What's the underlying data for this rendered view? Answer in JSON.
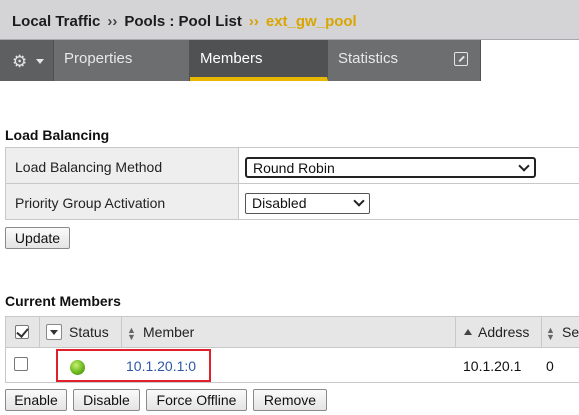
{
  "breadcrumb": {
    "section": "Local Traffic",
    "separator": "››",
    "page": "Pools : Pool List",
    "current": "ext_gw_pool"
  },
  "tabs": {
    "properties": "Properties",
    "members": "Members",
    "statistics": "Statistics",
    "active": "Members"
  },
  "load_balancing": {
    "title": "Load Balancing",
    "method_label": "Load Balancing Method",
    "method_value": "Round Robin",
    "priority_label": "Priority Group Activation",
    "priority_value": "Disabled",
    "update_button": "Update"
  },
  "current_members": {
    "title": "Current Members",
    "columns": {
      "status": "Status",
      "member": "Member",
      "address": "Address",
      "service": "Se"
    },
    "rows": [
      {
        "status": "available-green",
        "member": "10.1.20.1:0",
        "address": "10.1.20.1",
        "service_port": "0"
      }
    ],
    "buttons": {
      "enable": "Enable",
      "disable": "Disable",
      "force_offline": "Force Offline",
      "remove": "Remove"
    }
  },
  "colors": {
    "accent_tab": "#e8b700",
    "breadcrumb_current": "#d9a600",
    "highlight_box": "#e0202a",
    "status_available": "#6ab81e",
    "link": "#2f57a8"
  },
  "icons": {
    "tab_menu": "gear-icon",
    "statistics_popout": "popout-icon"
  }
}
